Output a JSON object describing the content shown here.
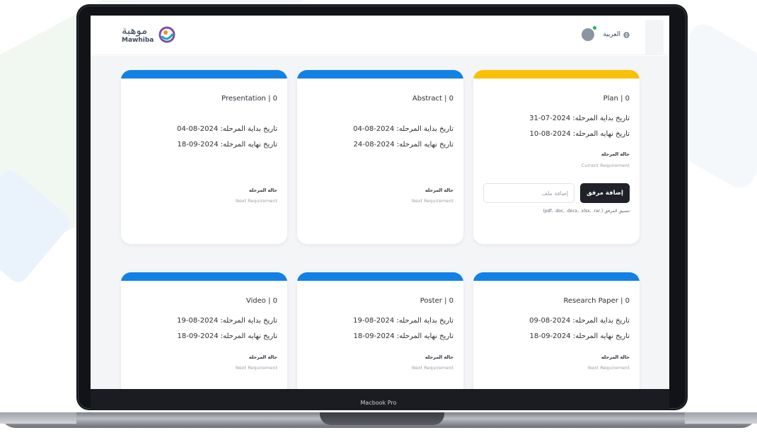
{
  "header": {
    "logo_ar": "موهبة",
    "logo_en": "Mawhiba",
    "language": "العربية"
  },
  "device": {
    "label": "Macbook Pro"
  },
  "colors": {
    "blue": "#1281e6",
    "yellow": "#f9c006"
  },
  "upload": {
    "button_label": "إضافة مرفق",
    "placeholder": "إضافة ملف",
    "format_hint": "تنسيق المرفق (.pdf, .doc, .docx, .xlsx, .rar)"
  },
  "cards": [
    {
      "title": "Plan | 0",
      "start": "تاريخ بداية المرحله: 2024-07-31",
      "end": "تاريخ نهايه المرحله: 2024-08-10",
      "status_label": "حالة المرحله",
      "status_value": "Current Requirement",
      "bar_color": "#f9c006"
    },
    {
      "title": "Abstract | 0",
      "start": "تاريخ بداية المرحله: 2024-08-04",
      "end": "تاريخ نهايه المرحله: 2024-08-24",
      "status_label": "حالة المرحله",
      "status_value": "Next Requirement",
      "bar_color": "#1281e6"
    },
    {
      "title": "Presentation | 0",
      "start": "تاريخ بداية المرحله: 2024-08-04",
      "end": "تاريخ نهايه المرحله: 2024-09-18",
      "status_label": "حالة المرحله",
      "status_value": "Next Requirement",
      "bar_color": "#1281e6"
    },
    {
      "title": "Research Paper | 0",
      "start": "تاريخ بداية المرحله: 2024-08-09",
      "end": "تاريخ نهايه المرحله: 2024-09-18",
      "status_label": "حالة المرحله",
      "status_value": "Next Requirement",
      "bar_color": "#1281e6"
    },
    {
      "title": "Poster | 0",
      "start": "تاريخ بداية المرحله: 2024-08-19",
      "end": "تاريخ نهايه المرحله: 2024-09-18",
      "status_label": "حالة المرحله",
      "status_value": "Next Requirement",
      "bar_color": "#1281e6"
    },
    {
      "title": "Video | 0",
      "start": "تاريخ بداية المرحله: 2024-08-19",
      "end": "تاريخ نهايه المرحله: 2024-09-18",
      "status_label": "حالة المرحله",
      "status_value": "Next Requirement",
      "bar_color": "#1281e6"
    }
  ]
}
